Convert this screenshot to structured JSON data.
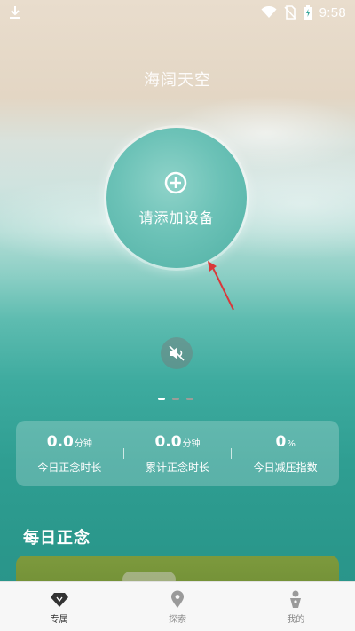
{
  "statusbar": {
    "time": "9:58"
  },
  "page": {
    "title": "海阔天空"
  },
  "device": {
    "add_label": "请添加设备"
  },
  "stats": [
    {
      "value": "0.0",
      "unit": "分钟",
      "label": "今日正念时长"
    },
    {
      "value": "0.0",
      "unit": "分钟",
      "label": "累计正念时长"
    },
    {
      "value": "0",
      "unit": "%",
      "label": "今日减压指数"
    }
  ],
  "daily": {
    "title": "每日正念"
  },
  "nav": [
    {
      "label": "专属",
      "icon": "diamond-icon",
      "active": true
    },
    {
      "label": "探索",
      "icon": "location-pin-icon",
      "active": false
    },
    {
      "label": "我的",
      "icon": "person-icon",
      "active": false
    }
  ],
  "colors": {
    "accent": "#3aa79b",
    "nav_bg": "#f7f7f7",
    "arrow": "#d9383a"
  }
}
